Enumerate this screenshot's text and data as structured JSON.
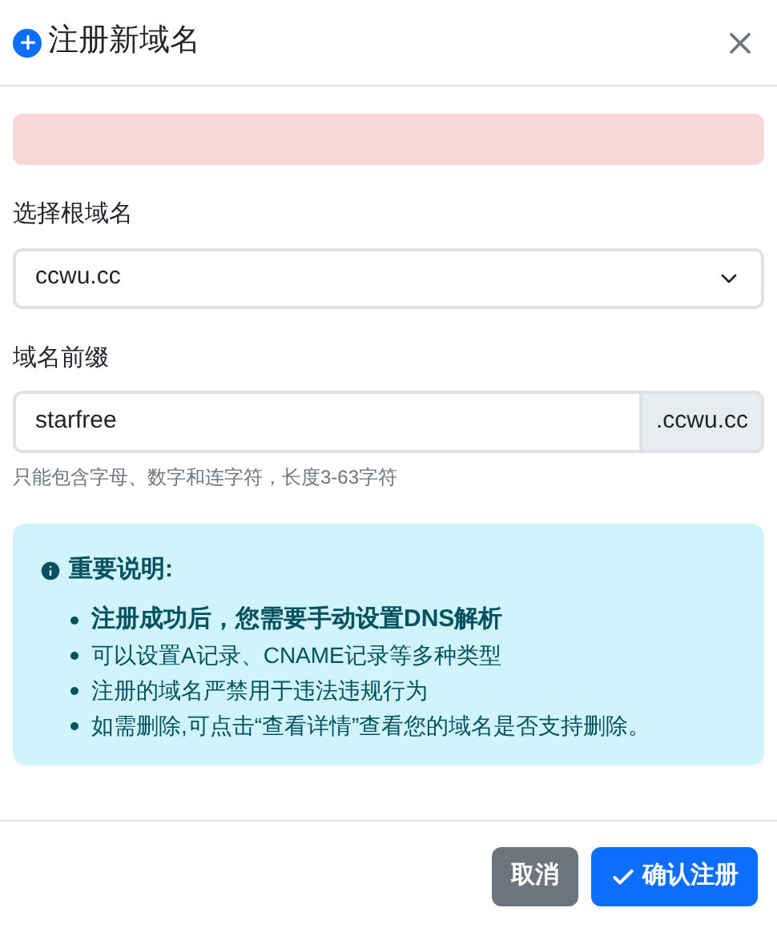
{
  "dialog": {
    "title": "注册新域名"
  },
  "alert": {
    "kind": "danger"
  },
  "root_domain": {
    "label": "选择根域名",
    "value": "ccwu.cc"
  },
  "prefix": {
    "label": "域名前缀",
    "value": "starfree",
    "suffix": ".ccwu.cc",
    "help": "只能包含字母、数字和连字符，长度3-63字符"
  },
  "notice": {
    "title": "重要说明:",
    "items": [
      {
        "text": "注册成功后，您需要手动设置DNS解析",
        "bold": true
      },
      {
        "text": "可以设置A记录、CNAME记录等多种类型",
        "bold": false
      },
      {
        "text": "注册的域名严禁用于违法违规行为",
        "bold": false
      },
      {
        "text": "如需删除,可点击“查看详情”查看您的域名是否支持删除。",
        "bold": false
      }
    ]
  },
  "buttons": [
    {
      "label": "取消",
      "kind": "secondary"
    },
    {
      "label": "确认注册",
      "kind": "primary"
    }
  ]
}
